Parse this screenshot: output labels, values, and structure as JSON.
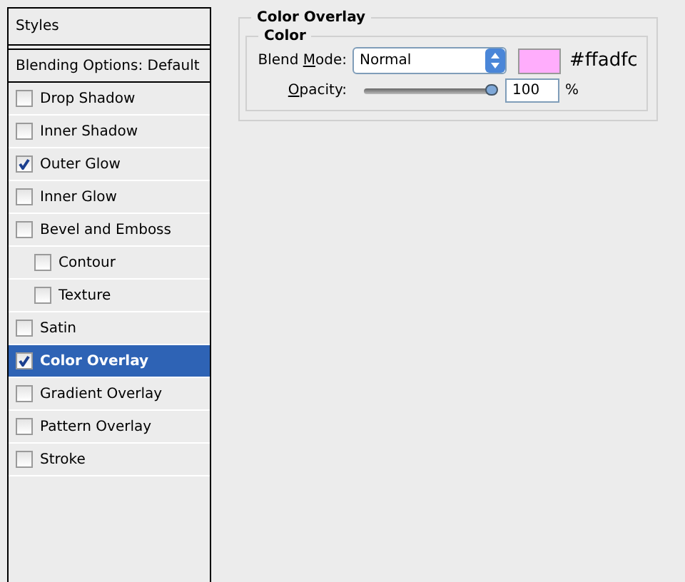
{
  "styles_panel": {
    "title": "Styles",
    "blending_options": "Blending Options: Default",
    "items": [
      {
        "label": "Drop Shadow",
        "checked": false,
        "selected": false
      },
      {
        "label": "Inner Shadow",
        "checked": false,
        "selected": false
      },
      {
        "label": "Outer Glow",
        "checked": true,
        "selected": false
      },
      {
        "label": "Inner Glow",
        "checked": false,
        "selected": false
      },
      {
        "label": "Bevel and Emboss",
        "checked": false,
        "selected": false,
        "children": [
          {
            "label": "Contour",
            "checked": false,
            "selected": false
          },
          {
            "label": "Texture",
            "checked": false,
            "selected": false
          }
        ]
      },
      {
        "label": "Satin",
        "checked": false,
        "selected": false
      },
      {
        "label": "Color Overlay",
        "checked": true,
        "selected": true
      },
      {
        "label": "Gradient Overlay",
        "checked": false,
        "selected": false
      },
      {
        "label": "Pattern Overlay",
        "checked": false,
        "selected": false
      },
      {
        "label": "Stroke",
        "checked": false,
        "selected": false
      }
    ]
  },
  "color_overlay": {
    "title": "Color Overlay",
    "group": {
      "title": "Color",
      "blend_mode": {
        "label": {
          "before": "Blend ",
          "key": "M",
          "after": "ode:"
        },
        "value": "Normal",
        "swatch": {
          "color": "#ffadfc"
        },
        "hex": "#ffadfc"
      },
      "opacity": {
        "label": {
          "key": "O",
          "after": "pacity:"
        },
        "level": 1,
        "value": "100",
        "unit": "%"
      }
    }
  }
}
